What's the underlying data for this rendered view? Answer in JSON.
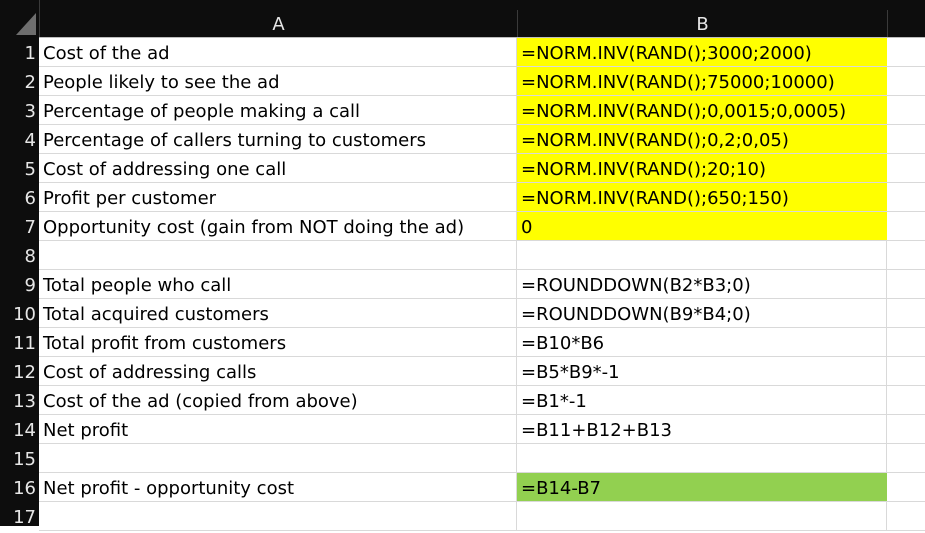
{
  "colors": {
    "input_highlight": "#ffff00",
    "result_highlight": "#92d050",
    "header_bg": "#0d0d0d",
    "header_text": "#e6e6e6",
    "gridline": "#d9d9d9"
  },
  "columns": [
    "A",
    "B"
  ],
  "rows": [
    {
      "num": "1",
      "a": "Cost of the ad",
      "b": "=NORM.INV(RAND();3000;2000)",
      "fill": "input_highlight"
    },
    {
      "num": "2",
      "a": "People likely to see the ad",
      "b": "=NORM.INV(RAND();75000;10000)",
      "fill": "input_highlight"
    },
    {
      "num": "3",
      "a": "Percentage of people making a call",
      "b": "=NORM.INV(RAND();0,0015;0,0005)",
      "fill": "input_highlight"
    },
    {
      "num": "4",
      "a": "Percentage of callers turning to customers",
      "b": "=NORM.INV(RAND();0,2;0,05)",
      "fill": "input_highlight"
    },
    {
      "num": "5",
      "a": "Cost of addressing one call",
      "b": "=NORM.INV(RAND();20;10)",
      "fill": "input_highlight"
    },
    {
      "num": "6",
      "a": "Profit per customer",
      "b": "=NORM.INV(RAND();650;150)",
      "fill": "input_highlight"
    },
    {
      "num": "7",
      "a": "Opportunity cost (gain from NOT doing the ad)",
      "b": "0",
      "fill": "input_highlight"
    },
    {
      "num": "8",
      "a": "",
      "b": "",
      "fill": ""
    },
    {
      "num": "9",
      "a": "Total people who call",
      "b": "=ROUNDDOWN(B2*B3;0)",
      "fill": ""
    },
    {
      "num": "10",
      "a": "Total acquired customers",
      "b": "=ROUNDDOWN(B9*B4;0)",
      "fill": ""
    },
    {
      "num": "11",
      "a": "Total profit from customers",
      "b": "=B10*B6",
      "fill": ""
    },
    {
      "num": "12",
      "a": "Cost of addressing calls",
      "b": "=B5*B9*-1",
      "fill": ""
    },
    {
      "num": "13",
      "a": "Cost of the ad (copied from above)",
      "b": "=B1*-1",
      "fill": ""
    },
    {
      "num": "14",
      "a": "Net profit",
      "b": "=B11+B12+B13",
      "fill": ""
    },
    {
      "num": "15",
      "a": "",
      "b": "",
      "fill": ""
    },
    {
      "num": "16",
      "a": "Net profit - opportunity cost",
      "b": "=B14-B7",
      "fill": "result_highlight"
    },
    {
      "num": "17",
      "a": "",
      "b": "",
      "fill": ""
    }
  ]
}
